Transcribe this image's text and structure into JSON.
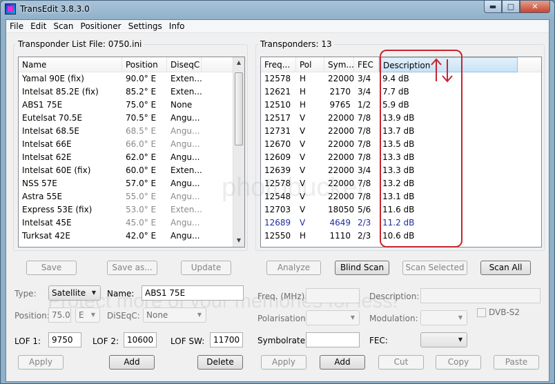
{
  "window": {
    "title": "TransEdit 3.8.3.0",
    "min_glyph": "▬",
    "max_glyph": "□",
    "close_glyph": "✕"
  },
  "menu": [
    "File",
    "Edit",
    "Scan",
    "Positioner",
    "Settings",
    "Info"
  ],
  "left_panel": {
    "label": "Transponder List File:  0750.ini",
    "columns": [
      "Name",
      "Position",
      "DiseqC"
    ],
    "rows": [
      {
        "name": "Yamal 90E (fix)",
        "position": "90.0° E",
        "diseqc": "Exten...",
        "dim": false
      },
      {
        "name": "Intelsat 85.2E (fix)",
        "position": "85.2° E",
        "diseqc": "Exten...",
        "dim": false
      },
      {
        "name": "ABS1 75E",
        "position": "75.0° E",
        "diseqc": "None",
        "dim": false
      },
      {
        "name": "Eutelsat 70.5E",
        "position": "70.5° E",
        "diseqc": "Angu...",
        "dim": false
      },
      {
        "name": "Intelsat 68.5E",
        "position": "68.5° E",
        "diseqc": "Angu...",
        "dim": true
      },
      {
        "name": "Intelsat 66E",
        "position": "66.0° E",
        "diseqc": "Angu...",
        "dim": true
      },
      {
        "name": "Intelsat 62E",
        "position": "62.0° E",
        "diseqc": "Angu...",
        "dim": false
      },
      {
        "name": "Intelsat 60E (fix)",
        "position": "60.0° E",
        "diseqc": "Exten...",
        "dim": false
      },
      {
        "name": "NSS 57E",
        "position": "57.0° E",
        "diseqc": "Angu...",
        "dim": false
      },
      {
        "name": "Astra 55E",
        "position": "55.0° E",
        "diseqc": "Angu...",
        "dim": true
      },
      {
        "name": "Express 53E (fix)",
        "position": "53.0° E",
        "diseqc": "Exten...",
        "dim": true
      },
      {
        "name": "Intelsat 45E",
        "position": "45.0° E",
        "diseqc": "Angu...",
        "dim": true
      },
      {
        "name": "Turksat 42E",
        "position": "42.0° E",
        "diseqc": "Angu...",
        "dim": false
      }
    ],
    "buttons": {
      "save": "Save",
      "save_as": "Save as...",
      "update": "Update"
    }
  },
  "right_panel": {
    "label": "Transponders: 13",
    "columns": [
      "Freq...",
      "Pol",
      "Sym...",
      "FEC",
      "Description"
    ],
    "rows": [
      {
        "freq": "12578",
        "pol": "H",
        "sym": "22000",
        "fec": "3/4",
        "desc": "9.4 dB",
        "blue": false
      },
      {
        "freq": "12621",
        "pol": "H",
        "sym": "2170",
        "fec": "3/4",
        "desc": "7.7 dB",
        "blue": false
      },
      {
        "freq": "12510",
        "pol": "H",
        "sym": "9765",
        "fec": "1/2",
        "desc": "5.9 dB",
        "blue": false
      },
      {
        "freq": "12517",
        "pol": "V",
        "sym": "22000",
        "fec": "7/8",
        "desc": "13.9 dB",
        "blue": false
      },
      {
        "freq": "12731",
        "pol": "V",
        "sym": "22000",
        "fec": "7/8",
        "desc": "13.7 dB",
        "blue": false
      },
      {
        "freq": "12670",
        "pol": "V",
        "sym": "22000",
        "fec": "7/8",
        "desc": "13.5 dB",
        "blue": false
      },
      {
        "freq": "12609",
        "pol": "V",
        "sym": "22000",
        "fec": "7/8",
        "desc": "13.3 dB",
        "blue": false
      },
      {
        "freq": "12639",
        "pol": "V",
        "sym": "22000",
        "fec": "3/4",
        "desc": "13.3 dB",
        "blue": false
      },
      {
        "freq": "12578",
        "pol": "V",
        "sym": "22000",
        "fec": "7/8",
        "desc": "13.2 dB",
        "blue": false
      },
      {
        "freq": "12548",
        "pol": "V",
        "sym": "22000",
        "fec": "7/8",
        "desc": "13.1 dB",
        "blue": false
      },
      {
        "freq": "12703",
        "pol": "V",
        "sym": "18050",
        "fec": "5/6",
        "desc": "11.6 dB",
        "blue": false
      },
      {
        "freq": "12689",
        "pol": "V",
        "sym": "4649",
        "fec": "2/3",
        "desc": "11.2 dB",
        "blue": true
      },
      {
        "freq": "12550",
        "pol": "H",
        "sym": "1110",
        "fec": "2/3",
        "desc": "10.6 dB",
        "blue": false
      }
    ],
    "buttons": {
      "analyze": "Analyze",
      "blind_scan": "Blind Scan",
      "scan_selected": "Scan Selected",
      "scan_all": "Scan All"
    }
  },
  "satellite_form": {
    "type_label": "Type:",
    "type_value": "Satellite",
    "name_label": "Name:",
    "name_value": "ABS1 75E",
    "position_label": "Position:",
    "position_value": "75.0",
    "position_dir": "E",
    "diseqc_label": "DiSEqC:",
    "diseqc_value": "None",
    "lof1_label": "LOF 1:",
    "lof1_value": "9750",
    "lof2_label": "LOF 2:",
    "lof2_value": "10600",
    "lofsw_label": "LOF SW:",
    "lofsw_value": "11700",
    "apply": "Apply",
    "add": "Add",
    "delete": "Delete"
  },
  "transponder_form": {
    "freq_label": "Freq. (MHz):",
    "description_label": "Description:",
    "polarisation_label": "Polarisation:",
    "modulation_label": "Modulation:",
    "dvbs2_label": "DVB-S2",
    "symbolrate_label": "Symbolrate:",
    "fec_label": "FEC:",
    "apply": "Apply",
    "add": "Add",
    "cut": "Cut",
    "copy": "Copy",
    "paste": "Paste"
  },
  "watermark": {
    "line1": "Protect more of your memories for less!",
    "line2": "photobucket"
  },
  "colors": {
    "annotation": "#c8232c",
    "selected_header": "#c8e2f6",
    "highlight_text": "#1d2c9e"
  }
}
